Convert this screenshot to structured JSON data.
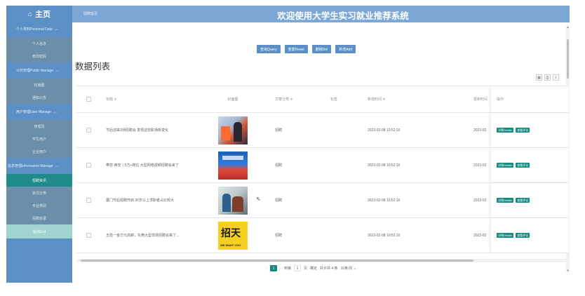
{
  "header": {
    "home_icon": "home-icon",
    "home_label": "主页",
    "breadcrumb": "招聘首页",
    "system_title": "欢迎使用大学生实习就业推荐系统"
  },
  "sidebar": {
    "groups": [
      {
        "label": "个人资料Personal Data",
        "items": [
          "个人信息",
          "修改密码"
        ]
      },
      {
        "label": "公共管理Public Manage",
        "items": [
          "轮播图",
          "通知公告"
        ]
      },
      {
        "label": "用户管理User Manage",
        "items": [
          "管理员",
          "学生用户",
          "企业用户"
        ]
      },
      {
        "label": "信息管理Information Manage",
        "items": [
          "招聘资讯",
          "资讯分类",
          "专业类别",
          "招聘目录"
        ]
      }
    ],
    "active_item": "招聘资讯",
    "logout_label": "退出Exit"
  },
  "toolbar": {
    "query": "查询Query",
    "reset": "重置Reset",
    "delete": "删除Del",
    "add": "新增Add"
  },
  "list_title": "数据列表",
  "tools": [
    "grid-icon",
    "print-icon",
    "export-icon"
  ],
  "table": {
    "headers": {
      "title": "标题 ≑",
      "cover": "封面图",
      "type": "文章分类 ≑",
      "tag": "标签",
      "time": "新增时间 ≑",
      "time2": "更新时间",
      "ops": "操作"
    },
    "rows": [
      {
        "title": "节后迎来3场招聘会 发现这些职场新变化",
        "type": "招聘",
        "tag": "",
        "time": "2023-02-08 10:52:16",
        "time2": "2023-02"
      },
      {
        "title": "带您·西安丨5万+岗位 大型网络视频招聘会来了",
        "type": "招聘",
        "tag": "",
        "time": "2023-02-08 10:52:16",
        "time2": "2023-02"
      },
      {
        "title": "厦门节后招聘开启 30岁以上求职者占比较大",
        "type": "招聘",
        "tag": "",
        "time": "2023-02-08 10:52:16",
        "time2": "2023-02"
      },
      {
        "title": "五险一金万元高薪，东莞大型现场招聘会来了...",
        "type": "招聘",
        "tag": "",
        "time": "2023-02-08 10:52:16",
        "time2": "2023-02"
      }
    ],
    "op_details": "详情Details",
    "op_comments": "查看评论"
  },
  "pagination": {
    "current": "1",
    "goto_prefix": "到第",
    "goto_value": "1",
    "goto_suffix": "页",
    "confirm": "确定",
    "total": "共计共 4 条",
    "page_size": "10条/页"
  },
  "colors": {
    "topbar": "#7aa7d6",
    "sidebar": "#5b8fc5",
    "accent": "#13897f",
    "logout": "#9fd4d1"
  }
}
